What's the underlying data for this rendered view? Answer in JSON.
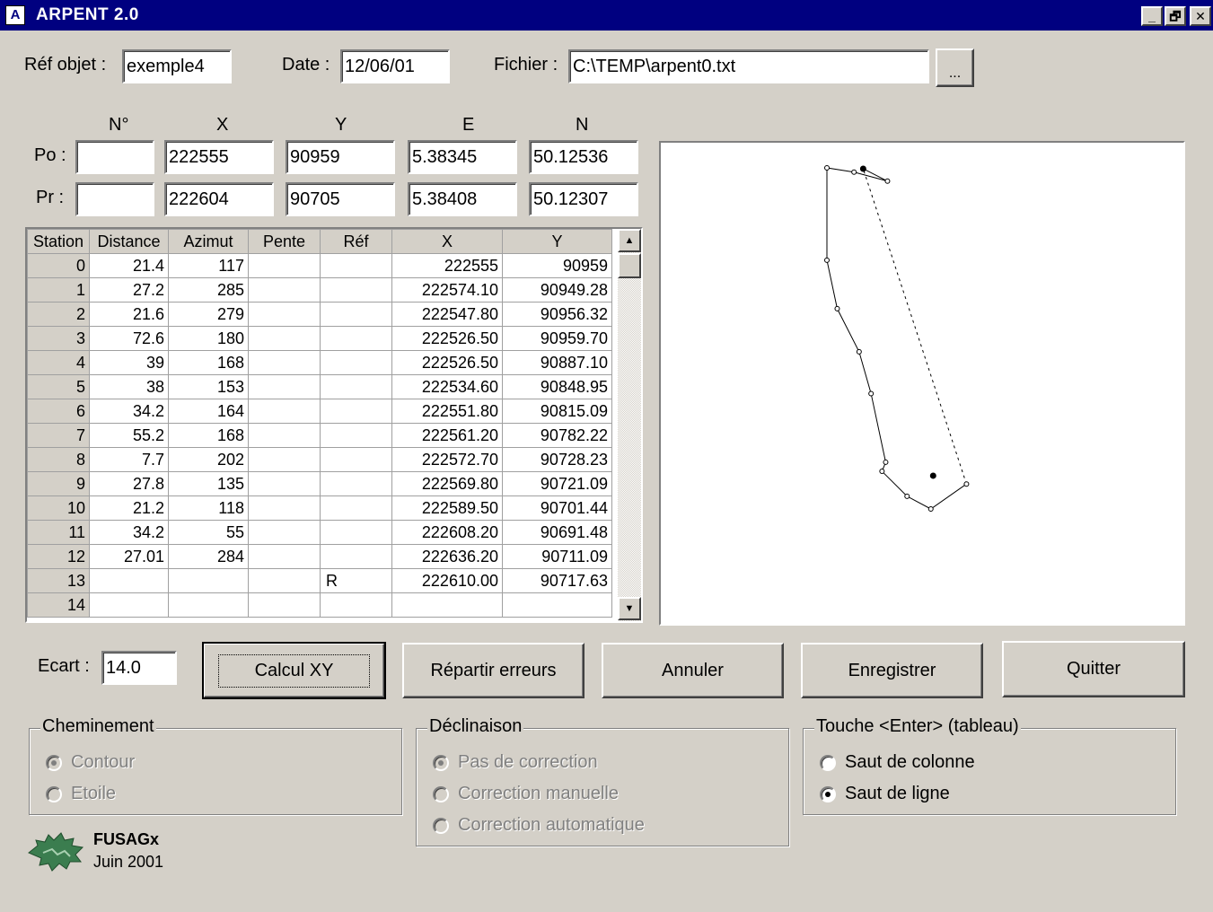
{
  "window": {
    "title": "ARPENT 2.0",
    "icon_label": "A",
    "minimize_glyph": "_",
    "restore_glyph": "🗗",
    "close_glyph": "✕"
  },
  "header": {
    "ref_label": "Réf objet :",
    "ref_value": "exemple4",
    "date_label": "Date :",
    "date_value": "12/06/01",
    "file_label": "Fichier :",
    "file_value": "C:\\TEMP\\arpent0.txt",
    "browse_label": "..."
  },
  "coords": {
    "headers": [
      "N°",
      "X",
      "Y",
      "E",
      "N"
    ],
    "po_label": "Po :",
    "pr_label": "Pr :",
    "po": [
      "",
      "222555",
      "90959",
      "5.38345",
      "50.12536"
    ],
    "pr": [
      "",
      "222604",
      "90705",
      "5.38408",
      "50.12307"
    ]
  },
  "table": {
    "columns": [
      "Station",
      "Distance",
      "Azimut",
      "Pente",
      "Réf",
      "X",
      "Y"
    ],
    "rows": [
      [
        "0",
        "21.4",
        "117",
        "",
        "",
        "222555",
        "90959"
      ],
      [
        "1",
        "27.2",
        "285",
        "",
        "",
        "222574.10",
        "90949.28"
      ],
      [
        "2",
        "21.6",
        "279",
        "",
        "",
        "222547.80",
        "90956.32"
      ],
      [
        "3",
        "72.6",
        "180",
        "",
        "",
        "222526.50",
        "90959.70"
      ],
      [
        "4",
        "39",
        "168",
        "",
        "",
        "222526.50",
        "90887.10"
      ],
      [
        "5",
        "38",
        "153",
        "",
        "",
        "222534.60",
        "90848.95"
      ],
      [
        "6",
        "34.2",
        "164",
        "",
        "",
        "222551.80",
        "90815.09"
      ],
      [
        "7",
        "55.2",
        "168",
        "",
        "",
        "222561.20",
        "90782.22"
      ],
      [
        "8",
        "7.7",
        "202",
        "",
        "",
        "222572.70",
        "90728.23"
      ],
      [
        "9",
        "27.8",
        "135",
        "",
        "",
        "222569.80",
        "90721.09"
      ],
      [
        "10",
        "21.2",
        "118",
        "",
        "",
        "222589.50",
        "90701.44"
      ],
      [
        "11",
        "34.2",
        "55",
        "",
        "",
        "222608.20",
        "90691.48"
      ],
      [
        "12",
        "27.01",
        "284",
        "",
        "",
        "222636.20",
        "90711.09"
      ],
      [
        "13",
        "",
        "",
        "",
        "R",
        "222610.00",
        "90717.63"
      ],
      [
        "14",
        "",
        "",
        "",
        "",
        "",
        ""
      ]
    ]
  },
  "actions": {
    "ecart_label": "Ecart :",
    "ecart_value": "14.0",
    "calcul": "Calcul XY",
    "repartir": "Répartir erreurs",
    "annuler": "Annuler",
    "enregistrer": "Enregistrer",
    "quitter": "Quitter"
  },
  "groups": {
    "cheminement": {
      "title": "Cheminement",
      "options": [
        {
          "label": "Contour",
          "checked": true,
          "enabled": false
        },
        {
          "label": "Etoile",
          "checked": false,
          "enabled": false
        }
      ]
    },
    "declinaison": {
      "title": "Déclinaison",
      "options": [
        {
          "label": "Pas de correction",
          "checked": true,
          "enabled": false
        },
        {
          "label": "Correction manuelle",
          "checked": false,
          "enabled": false
        },
        {
          "label": "Correction automatique",
          "checked": false,
          "enabled": false
        }
      ]
    },
    "touche": {
      "title": "Touche <Enter> (tableau)",
      "options": [
        {
          "label": "Saut de colonne",
          "checked": false,
          "enabled": true
        },
        {
          "label": "Saut de ligne",
          "checked": true,
          "enabled": true
        }
      ]
    }
  },
  "footer": {
    "org": "FUSAGx",
    "date": "Juin 2001"
  },
  "colors": {
    "titlebar": "#000080",
    "face": "#d4d0c8",
    "logo_green": "#3b7d4f"
  }
}
